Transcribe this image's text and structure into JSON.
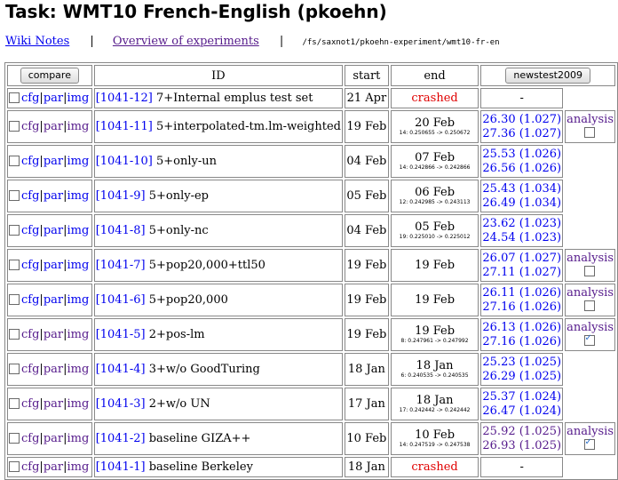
{
  "page": {
    "title": "Task: WMT10 French-English (pkoehn)",
    "nav": {
      "wiki": "Wiki Notes",
      "sep": "|",
      "overview": "Overview of experiments",
      "path": "/fs/saxnot1/pkoehn-experiment/wmt10-fr-en"
    }
  },
  "table": {
    "headers": {
      "compare": "compare",
      "id": "ID",
      "start": "start",
      "end": "end",
      "testset": "newstest2009"
    },
    "link_labels": {
      "cfg": "cfg",
      "par": "par",
      "img": "img",
      "sep": "|"
    },
    "analysis_label": "analysis",
    "rows": [
      {
        "id": "[1041-12]",
        "desc": "7+Internal emplus test set",
        "start": "21 Apr",
        "end": "crashed",
        "end_detail": "",
        "score1": "-",
        "score2": "",
        "analysis": false,
        "analysis_checked": false
      },
      {
        "id": "[1041-11]",
        "desc": "5+interpolated-tm.lm-weighted",
        "start": "19 Feb",
        "end": "20 Feb",
        "end_detail": "14: 0.250655 -> 0.250672",
        "score1": "26.30 (1.027)",
        "score2": "27.36 (1.027)",
        "analysis": true,
        "analysis_checked": false
      },
      {
        "id": "[1041-10]",
        "desc": "5+only-un",
        "start": "04 Feb",
        "end": "07 Feb",
        "end_detail": "14: 0.242866 -> 0.242866",
        "score1": "25.53 (1.026)",
        "score2": "26.56 (1.026)",
        "analysis": false,
        "analysis_checked": false
      },
      {
        "id": "[1041-9]",
        "desc": "5+only-ep",
        "start": "05 Feb",
        "end": "06 Feb",
        "end_detail": "12: 0.242985 -> 0.243113",
        "score1": "25.43 (1.034)",
        "score2": "26.49 (1.034)",
        "analysis": false,
        "analysis_checked": false
      },
      {
        "id": "[1041-8]",
        "desc": "5+only-nc",
        "start": "04 Feb",
        "end": "05 Feb",
        "end_detail": "19: 0.225010 -> 0.225012",
        "score1": "23.62 (1.023)",
        "score2": "24.54 (1.023)",
        "analysis": false,
        "analysis_checked": false
      },
      {
        "id": "[1041-7]",
        "desc": "5+pop20,000+ttl50",
        "start": "19 Feb",
        "end": "19 Feb",
        "end_detail": "",
        "score1": "26.07 (1.027)",
        "score2": "27.11 (1.027)",
        "analysis": true,
        "analysis_checked": false
      },
      {
        "id": "[1041-6]",
        "desc": "5+pop20,000",
        "start": "19 Feb",
        "end": "19 Feb",
        "end_detail": "",
        "score1": "26.11 (1.026)",
        "score2": "27.16 (1.026)",
        "analysis": true,
        "analysis_checked": false
      },
      {
        "id": "[1041-5]",
        "desc": "2+pos-lm",
        "start": "19 Feb",
        "end": "19 Feb",
        "end_detail": "8: 0.247961 -> 0.247992",
        "score1": "26.13 (1.026)",
        "score2": "27.16 (1.026)",
        "analysis": true,
        "analysis_checked": true
      },
      {
        "id": "[1041-4]",
        "desc": "3+w/o GoodTuring",
        "start": "18 Jan",
        "end": "18 Jan",
        "end_detail": "6: 0.240535 -> 0.240535",
        "score1": "25.23 (1.025)",
        "score2": "26.29 (1.025)",
        "analysis": false,
        "analysis_checked": false
      },
      {
        "id": "[1041-3]",
        "desc": "2+w/o UN",
        "start": "17 Jan",
        "end": "18 Jan",
        "end_detail": "17: 0.242442 -> 0.242442",
        "score1": "25.37 (1.024)",
        "score2": "26.47 (1.024)",
        "analysis": false,
        "analysis_checked": false
      },
      {
        "id": "[1041-2]",
        "desc": "baseline GIZA++",
        "start": "10 Feb",
        "end": "10 Feb",
        "end_detail": "14: 0.247519 -> 0.247538",
        "score1": "25.92 (1.025)",
        "score2": "26.93 (1.025)",
        "analysis": true,
        "analysis_checked": true
      },
      {
        "id": "[1041-1]",
        "desc": "baseline Berkeley",
        "start": "18 Jan",
        "end": "crashed",
        "end_detail": "",
        "score1": "-",
        "score2": "",
        "analysis": false,
        "analysis_checked": false
      }
    ]
  },
  "colors": {
    "crashed": "#e00000",
    "link": "#0000ee",
    "visited": "#551a8b"
  }
}
